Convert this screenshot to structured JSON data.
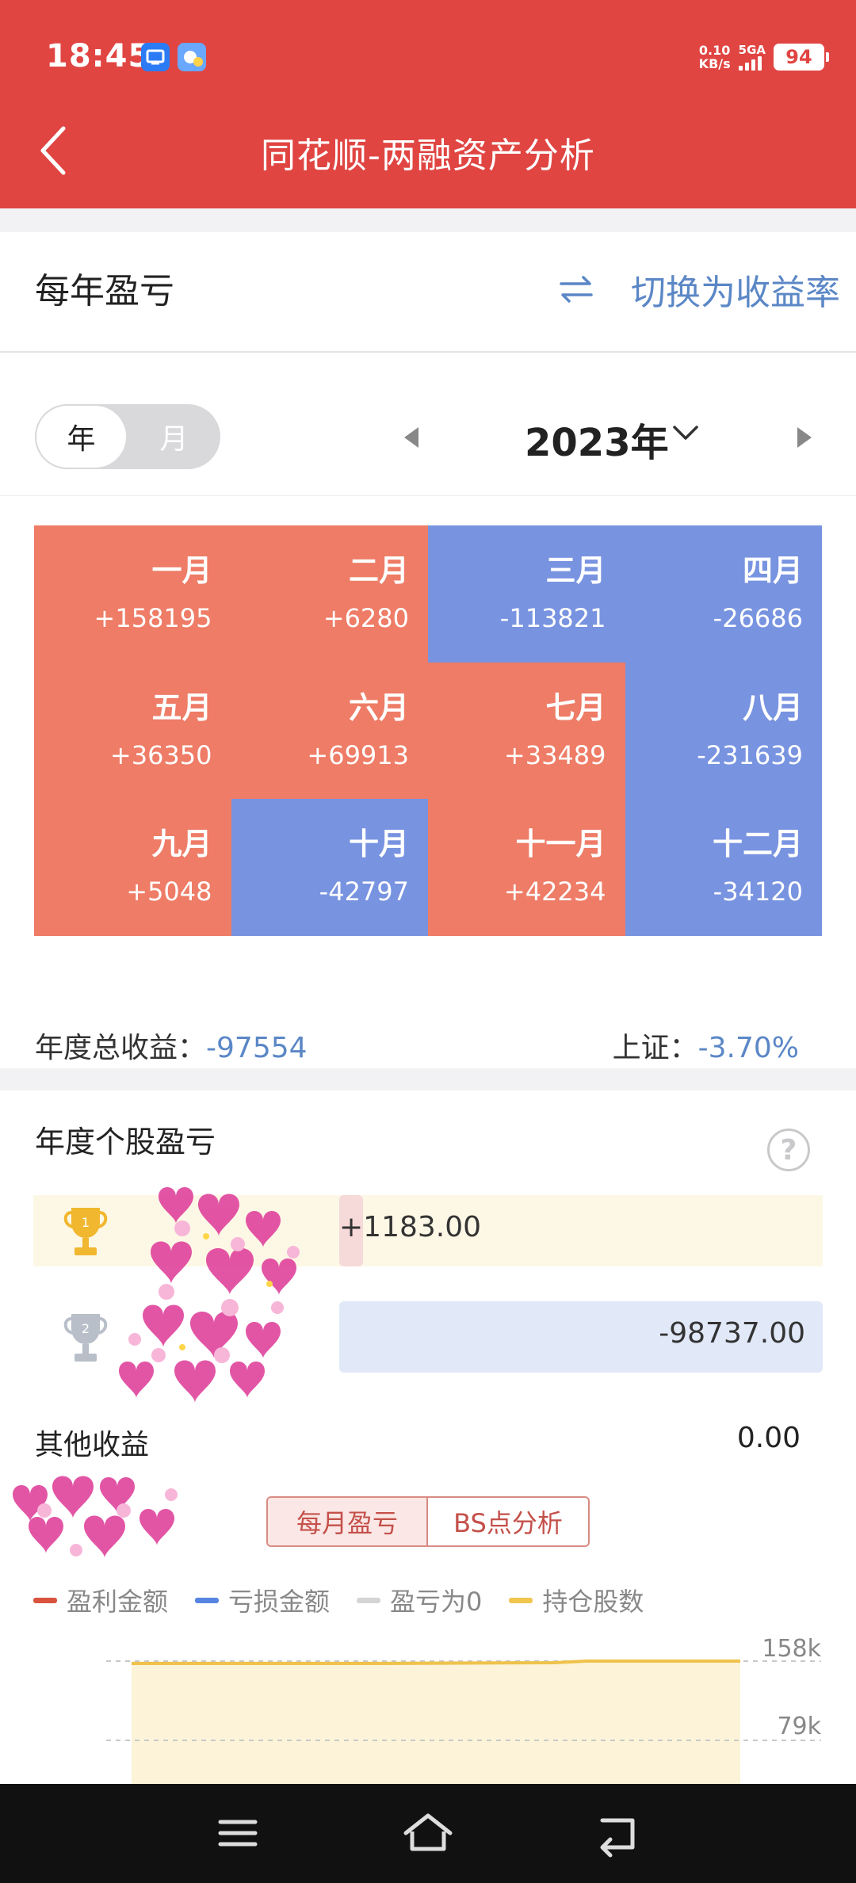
{
  "status_bar": {
    "time": "18:45",
    "net_speed_top": "0.10",
    "net_speed_bottom": "KB/s",
    "signal": "5GA",
    "battery": "94"
  },
  "header": {
    "title": "同花顺-两融资产分析",
    "back_icon": "chevron-left-icon"
  },
  "annual_pl": {
    "title": "每年盈亏",
    "switch_label": "切换为收益率",
    "period_toggle": [
      {
        "label": "年",
        "active": true
      },
      {
        "label": "月",
        "active": false
      }
    ],
    "year": "2023年",
    "months": [
      {
        "name": "一月",
        "value": "+158195",
        "positive": true
      },
      {
        "name": "二月",
        "value": "+6280",
        "positive": true
      },
      {
        "name": "三月",
        "value": "-113821",
        "positive": false
      },
      {
        "name": "四月",
        "value": "-26686",
        "positive": false
      },
      {
        "name": "五月",
        "value": "+36350",
        "positive": true
      },
      {
        "name": "六月",
        "value": "+69913",
        "positive": true
      },
      {
        "name": "七月",
        "value": "+33489",
        "positive": true
      },
      {
        "name": "八月",
        "value": "-231639",
        "positive": false
      },
      {
        "name": "九月",
        "value": "+5048",
        "positive": true
      },
      {
        "name": "十月",
        "value": "-42797",
        "positive": false
      },
      {
        "name": "十一月",
        "value": "+42234",
        "positive": true
      },
      {
        "name": "十二月",
        "value": "-34120",
        "positive": false
      }
    ],
    "total_label": "年度总收益：",
    "total_value": "-97554",
    "index_label": "上证：",
    "index_value": "-3.70%",
    "colors": {
      "positive": "#ee7c66",
      "negative": "#7893e0"
    }
  },
  "stock_pl": {
    "title": "年度个股盈亏",
    "help": "?",
    "ranks": [
      {
        "rank": "1",
        "value": "+1183.00"
      },
      {
        "rank": "2",
        "value": "-98737.00"
      }
    ],
    "other_label": "其他收益",
    "other_value": "0.00",
    "tabs": [
      "每月盈亏",
      "BS点分析"
    ],
    "legend": [
      {
        "label": "盈利金额",
        "color": "#d9533e"
      },
      {
        "label": "亏损金额",
        "color": "#5585e0"
      },
      {
        "label": "盈亏为0",
        "color": "#d5d5d5"
      },
      {
        "label": "持仓股数",
        "color": "#f1c64f"
      }
    ],
    "chart_ticks": [
      "158k",
      "79k"
    ]
  },
  "nav": {
    "menu_icon": "menu-icon",
    "home_icon": "home-icon",
    "back_icon": "back-icon"
  }
}
